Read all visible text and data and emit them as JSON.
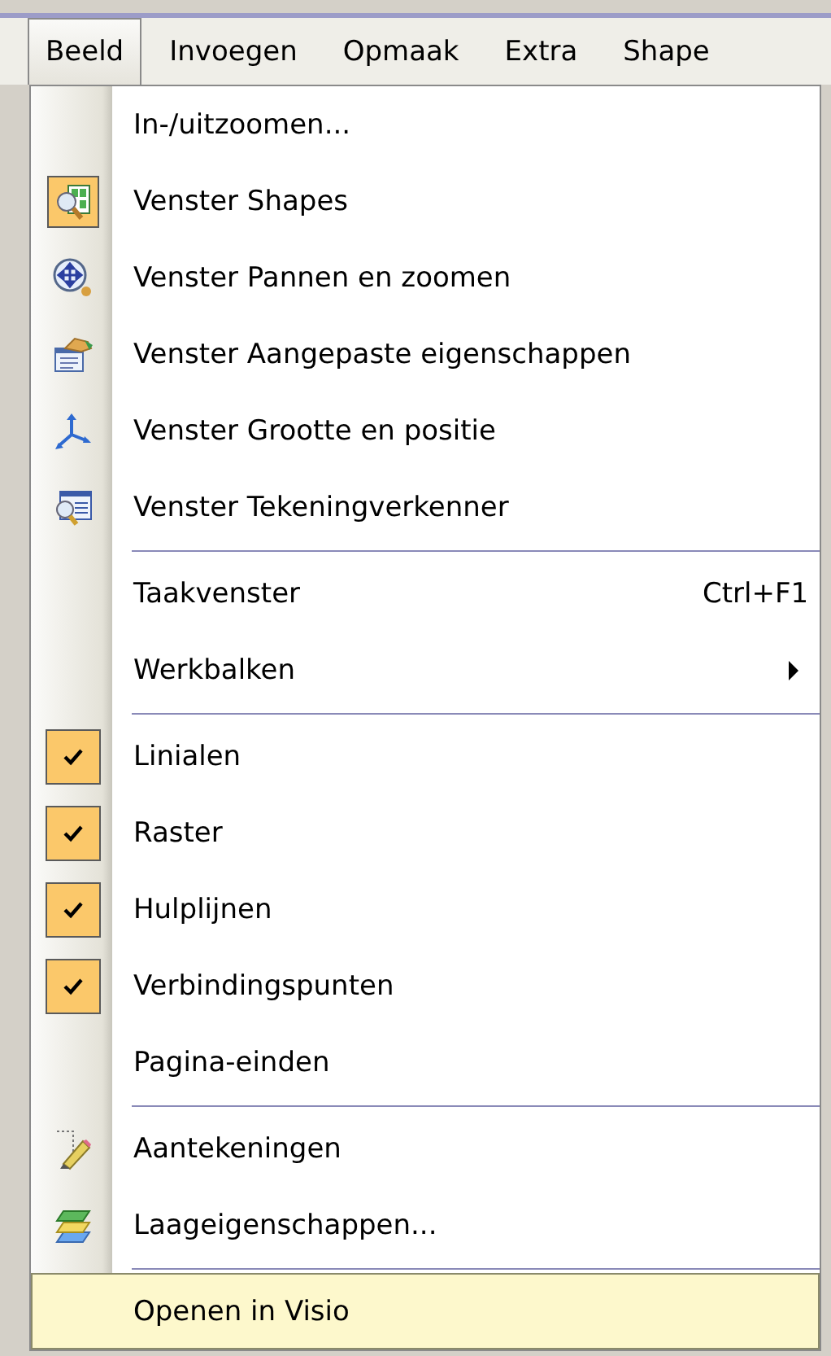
{
  "menubar": [
    {
      "label": "Beeld",
      "selected": true
    },
    {
      "label": "Invoegen",
      "selected": false
    },
    {
      "label": "Opmaak",
      "selected": false
    },
    {
      "label": "Extra",
      "selected": false
    },
    {
      "label": "Shape",
      "selected": false
    }
  ],
  "menu": {
    "items": [
      {
        "kind": "item",
        "label": "In-/uitzoomen...",
        "checked": false,
        "highlighted": false
      },
      {
        "kind": "item",
        "label": "Venster Shapes",
        "checked": true,
        "highlighted": false
      },
      {
        "kind": "item",
        "label": "Venster Pannen en zoomen",
        "checked": false,
        "highlighted": false
      },
      {
        "kind": "item",
        "label": "Venster Aangepaste eigenschappen",
        "checked": false,
        "highlighted": false
      },
      {
        "kind": "item",
        "label": "Venster Grootte en positie",
        "checked": false,
        "highlighted": false
      },
      {
        "kind": "item",
        "label": "Venster Tekeningverkenner",
        "checked": false,
        "highlighted": false
      },
      {
        "kind": "separator"
      },
      {
        "kind": "item",
        "label": "Taakvenster",
        "shortcut": "Ctrl+F1",
        "checked": false,
        "highlighted": false
      },
      {
        "kind": "submenu",
        "label": "Werkbalken",
        "checked": false,
        "highlighted": false
      },
      {
        "kind": "separator"
      },
      {
        "kind": "item",
        "label": "Linialen",
        "checked": true,
        "highlighted": false
      },
      {
        "kind": "item",
        "label": "Raster",
        "checked": true,
        "highlighted": false
      },
      {
        "kind": "item",
        "label": "Hulplijnen",
        "checked": true,
        "highlighted": false
      },
      {
        "kind": "item",
        "label": "Verbindingspunten",
        "checked": true,
        "highlighted": false
      },
      {
        "kind": "item",
        "label": "Pagina-einden",
        "checked": false,
        "highlighted": false
      },
      {
        "kind": "separator"
      },
      {
        "kind": "item",
        "label": "Aantekeningen",
        "checked": false,
        "highlighted": false
      },
      {
        "kind": "item",
        "label": "Laageigenschappen...",
        "checked": false,
        "highlighted": false
      },
      {
        "kind": "separator"
      },
      {
        "kind": "item",
        "label": "Openen in Visio",
        "checked": false,
        "highlighted": true
      }
    ]
  }
}
